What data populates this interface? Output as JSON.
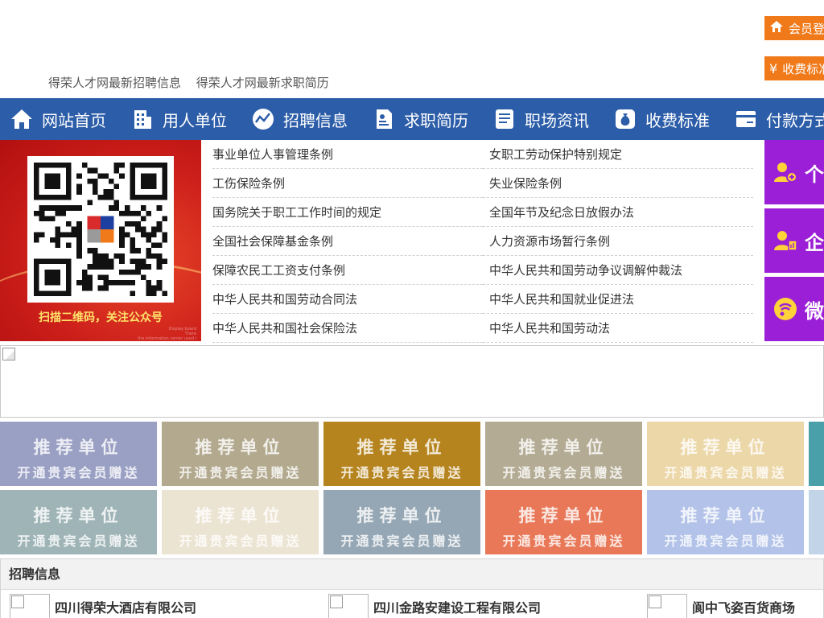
{
  "header": {
    "links": [
      "得荣人才网最新招聘信息",
      "得荣人才网最新求职简历"
    ],
    "member_login": "会员登录",
    "fees": "收费标准"
  },
  "nav": [
    {
      "label": "网站首页",
      "icon": "home-icon"
    },
    {
      "label": "用人单位",
      "icon": "building-icon"
    },
    {
      "label": "招聘信息",
      "icon": "chart-icon"
    },
    {
      "label": "求职简历",
      "icon": "resume-icon"
    },
    {
      "label": "职场资讯",
      "icon": "news-icon"
    },
    {
      "label": "收费标准",
      "icon": "money-bag-icon"
    },
    {
      "label": "付款方式",
      "icon": "card-icon"
    }
  ],
  "qr": {
    "caption": "扫描二维码，关注公众号",
    "small_text": "Display board\nThere\nthe information center used i"
  },
  "laws": [
    [
      "事业单位人事管理条例",
      "女职工劳动保护特别规定"
    ],
    [
      "工伤保险条例",
      "失业保险条例"
    ],
    [
      "国务院关于职工工作时间的规定",
      "全国年节及纪念日放假办法"
    ],
    [
      "全国社会保障基金条例",
      "人力资源市场暂行条例"
    ],
    [
      "保障农民工工资支付条例",
      "中华人民共和国劳动争议调解仲裁法"
    ],
    [
      "中华人民共和国劳动合同法",
      "中华人民共和国就业促进法"
    ],
    [
      "中华人民共和国社会保险法",
      "中华人民共和国劳动法"
    ]
  ],
  "side_tiles": [
    {
      "label": "个",
      "icon": "person-add-icon"
    },
    {
      "label": "企",
      "icon": "company-user-icon"
    },
    {
      "label": "微",
      "icon": "wechat-icon"
    }
  ],
  "recommend": {
    "title": "推荐单位",
    "subtitle": "开通贵宾会员赠送",
    "row1_colors": [
      "#9aa0c4",
      "#b3a98e",
      "#b5841e",
      "#b3ab93",
      "#ecd7a8",
      "#4aa0a8"
    ],
    "row2_colors": [
      "#9fb4b7",
      "#ece4d3",
      "#95a7b4",
      "#e87858",
      "#b2c2e8",
      "#c2d4e8"
    ]
  },
  "jobs": {
    "header": "招聘信息",
    "items": [
      "四川得荣大酒店有限公司",
      "四川金路安建设工程有限公司",
      "阆中飞姿百货商场"
    ]
  }
}
